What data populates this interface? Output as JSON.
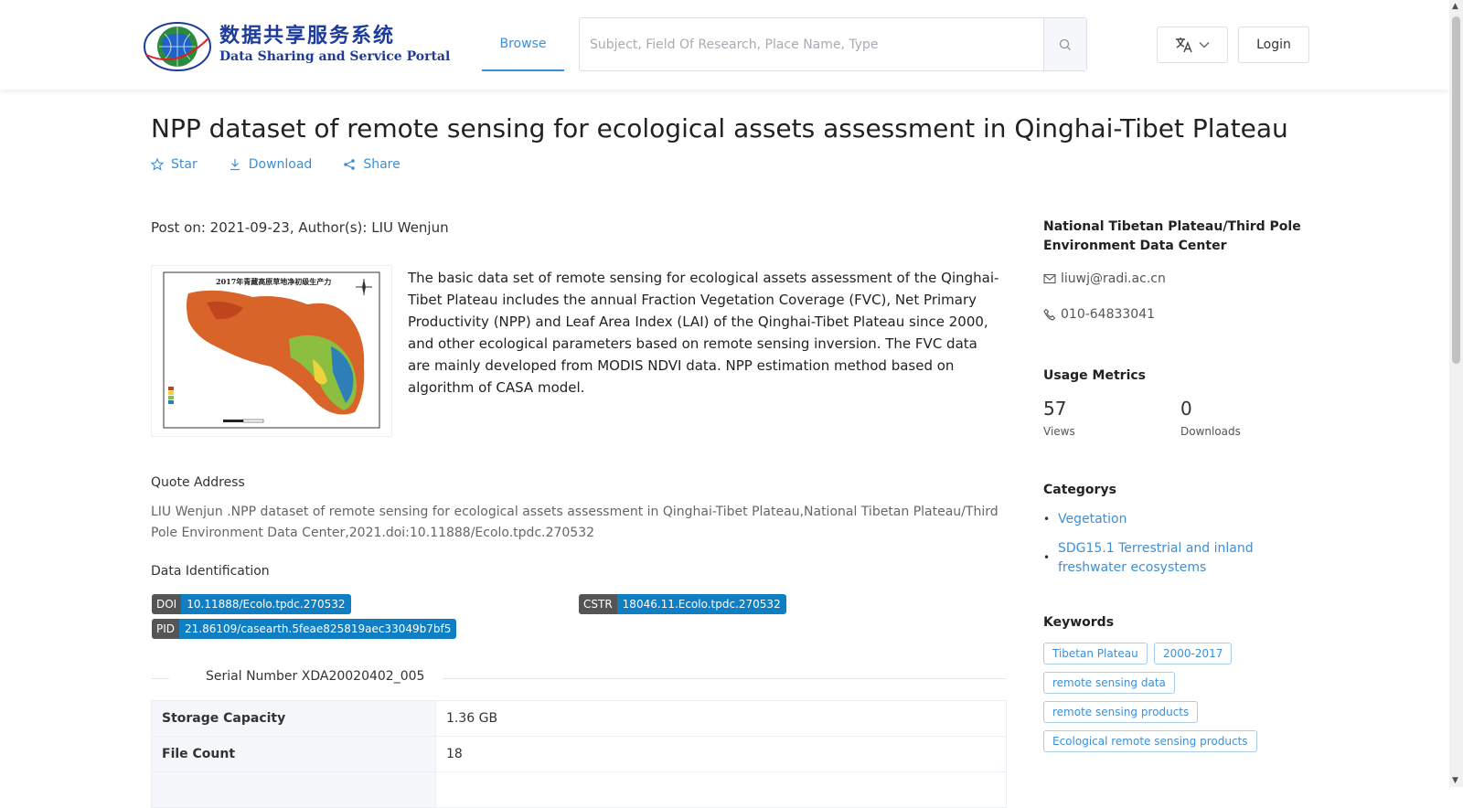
{
  "header": {
    "logo_cn": "数据共享服务系统",
    "logo_en": "Data Sharing and Service Portal",
    "nav_browse": "Browse",
    "search_placeholder": "Subject, Field Of Research, Place Name, Type",
    "search_value": "",
    "login_label": "Login"
  },
  "dataset": {
    "title": "NPP dataset of remote sensing for ecological assets assessment in Qinghai-Tibet Plateau",
    "actions": {
      "star": "Star",
      "download": "Download",
      "share": "Share"
    },
    "post_meta": "Post on: 2021-09-23, Author(s): LIU Wenjun",
    "thumbnail_title": "2017年青藏高原草地净初级生产力",
    "abstract": "The basic data set of remote sensing for ecological assets assessment of the Qinghai-Tibet Plateau includes the annual Fraction Vegetation Coverage (FVC), Net Primary Productivity (NPP) and Leaf Area Index (LAI) of the Qinghai-Tibet Plateau since 2000, and other ecological parameters based on remote sensing inversion. The FVC data are mainly developed from MODIS NDVI data. NPP estimation method based on algorithm of CASA model.",
    "quote_label": "Quote Address",
    "quote_text": "LIU Wenjun .NPP dataset of remote sensing for ecological assets assessment in Qinghai-Tibet Plateau,National Tibetan Plateau/Third Pole Environment Data Center,2021.doi:10.11888/Ecolo.tpdc.270532",
    "identification_label": "Data Identification",
    "identifiers": {
      "doi_key": "DOI",
      "doi_value": "10.11888/Ecolo.tpdc.270532",
      "cstr_key": "CSTR",
      "cstr_value": "18046.11.Ecolo.tpdc.270532",
      "pid_key": "PID",
      "pid_value": "21.86109/casearth.5feae825819aec33049b7bf5"
    },
    "serial_number": "Serial Number XDA20020402_005",
    "info_rows": [
      {
        "label": "Storage Capacity",
        "value": "1.36 GB"
      },
      {
        "label": "File Count",
        "value": "18"
      }
    ]
  },
  "sidebar": {
    "org": "National Tibetan Plateau/Third Pole Environment Data Center",
    "email": "liuwj@radi.ac.cn",
    "phone": "010-64833041",
    "usage_title": "Usage Metrics",
    "views_count": "57",
    "views_label": "Views",
    "downloads_count": "0",
    "downloads_label": "Downloads",
    "categories_title": "Categorys",
    "categories": [
      "Vegetation",
      "SDG15.1 Terrestrial and inland freshwater ecosystems"
    ],
    "keywords_title": "Keywords",
    "keywords": [
      "Tibetan Plateau",
      "2000-2017",
      "remote sensing data",
      "remote sensing products",
      "Ecological remote sensing products"
    ]
  },
  "colors": {
    "accent": "#3d8fd6",
    "tag_value_bg": "#0f7ec3",
    "tag_key_bg": "#555555"
  }
}
